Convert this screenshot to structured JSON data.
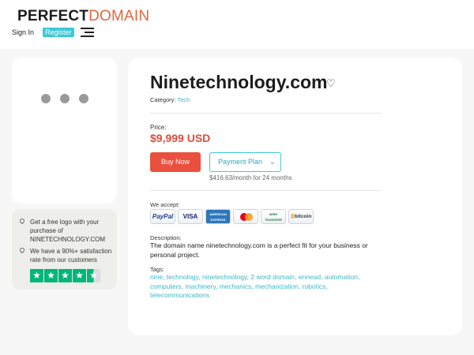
{
  "header": {
    "logo_bold": "PERFECT",
    "logo_light": "DOMAIN",
    "signin_label": "Sign In",
    "register_label": "Register",
    "menu_icon": "hamburger-menu-icon"
  },
  "image_card": {
    "loading_dots": 3
  },
  "promo": {
    "items": [
      "Get a free logo with your purchase of NINETECHNOLOGY.COM",
      "We have a 90%+ satisfaction rate from our customers"
    ],
    "rating_stars": 4.5
  },
  "domain": {
    "name": "Ninetechnology.com",
    "category_label": "Category:",
    "category": "Tech",
    "price_label": "Price:",
    "price": "$9,999 USD",
    "buy_label": "Buy Now",
    "plan_label": "Payment Plan",
    "monthly": "$416.63/month for 24 months",
    "accept_label": "We accept:",
    "payment_methods": [
      "PayPal",
      "VISA",
      "AMERICAN EXPRESS",
      "mastercard",
      "WIRE TRANSFER",
      "bitcoin"
    ],
    "description_label": "Description:",
    "description": "The domain name ninetechnology.com is a perfect fit for your business or personal project.",
    "tags_label": "Tags:",
    "tags": "nine, technology, ninetechnology, 2 word domain, ennead, automation, computers, machinery, mechanics, mechanization, robotics, telecommunications"
  },
  "colors": {
    "accent": "#3cc8d6",
    "price": "#e24b3a",
    "buy_button": "#e9503d",
    "trustpilot": "#00b67a"
  }
}
